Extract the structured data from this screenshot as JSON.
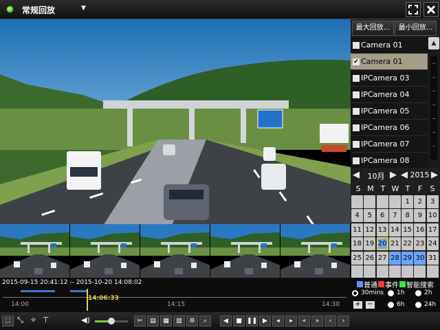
{
  "header": {
    "title": "常规回放",
    "dropdown_icon": "chevron-down-icon"
  },
  "window_buttons": {
    "fullscreen_icon": "fullscreen-icon",
    "close_icon": "close-icon"
  },
  "modes": {
    "max_playback": "最大回放...",
    "min_playback": "最小回放..."
  },
  "cameras": [
    {
      "label": "Camera 01",
      "checked": false,
      "selected": false
    },
    {
      "label": "Camera 01",
      "checked": true,
      "selected": true
    },
    {
      "label": "IPCamera 03",
      "checked": false,
      "selected": false
    },
    {
      "label": "IPCamera 04",
      "checked": false,
      "selected": false
    },
    {
      "label": "IPCamera 05",
      "checked": false,
      "selected": false
    },
    {
      "label": "IPCamera 06",
      "checked": false,
      "selected": false
    },
    {
      "label": "IPCamera 07",
      "checked": false,
      "selected": false
    },
    {
      "label": "IPCamera 08",
      "checked": false,
      "selected": false
    }
  ],
  "calendar": {
    "month": "10月",
    "year": "2015",
    "weekdays": [
      "S",
      "M",
      "T",
      "W",
      "T",
      "F",
      "S"
    ],
    "leading_blanks": 4,
    "days": 31,
    "trailing_blanks": 7,
    "marked_days": [
      20,
      28,
      29,
      30
    ],
    "today": 20
  },
  "timeline": {
    "range": "2015-09-15 20:41:12 -- 2015-10-20 14:08:02",
    "cursor_time": "14:06:33",
    "ticks": [
      "14:00",
      "14:15",
      "14:30"
    ]
  },
  "legend": [
    {
      "label": "普通",
      "color": "#6a8cff"
    },
    {
      "label": "事件",
      "color": "#ff3b3b"
    },
    {
      "label": "智能搜索",
      "color": "#39e639"
    }
  ],
  "intervals": [
    {
      "label": "30mins",
      "selected": true
    },
    {
      "label": "1h",
      "selected": false
    },
    {
      "label": "2h",
      "selected": false
    },
    {
      "label": "6h",
      "selected": false
    },
    {
      "label": "24h",
      "selected": false
    }
  ],
  "zoom": {
    "plus": "+",
    "minus": "−"
  },
  "volume_level": 0.5,
  "toolbar": {
    "left_icons": [
      "split-screen-icon",
      "zoom-line-icon",
      "digital-zoom-icon",
      "filter-icon"
    ],
    "media_icons": [
      "volume-icon",
      "clip-icon",
      "tag-add-icon",
      "tag-custom-icon",
      "tag-manage-icon",
      "settings-icon",
      "search-icon"
    ],
    "playback_icons": [
      "reverse-play-icon",
      "stop-icon",
      "pause-icon",
      "play-icon",
      "step-back-icon",
      "step-forward-icon",
      "slow-icon",
      "fast-icon",
      "prev-icon",
      "next-icon"
    ]
  }
}
